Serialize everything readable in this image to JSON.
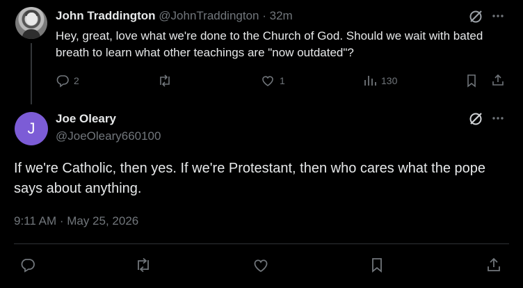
{
  "reply": {
    "author_name": "John Traddington",
    "handle": "@JohnTraddington",
    "separator": "·",
    "time": "32m",
    "text": "Hey, great, love what we're done to the Church of God. Should we wait with bated breath to learn what other teachings are \"now outdated\"?",
    "replies_count": "2",
    "likes_count": "1",
    "views_count": "130",
    "icons": [
      "grok-icon",
      "more-icon",
      "reply-icon",
      "retweet-icon",
      "like-icon",
      "views-icon",
      "bookmark-icon",
      "share-icon"
    ]
  },
  "main_tweet": {
    "avatar_letter": "J",
    "avatar_color": "#7c5cd6",
    "author_name": "Joe Oleary",
    "handle": "@JoeOleary660100",
    "text": "If we're Catholic, then yes.  If we're Protestant, then who cares what the pope says about anything.",
    "timestamp": "9:11 AM · May 25, 2026"
  },
  "colors": {
    "background": "#000000",
    "primary_text": "#e7e9ea",
    "secondary_text": "#71767b",
    "divider": "#2f3336"
  }
}
